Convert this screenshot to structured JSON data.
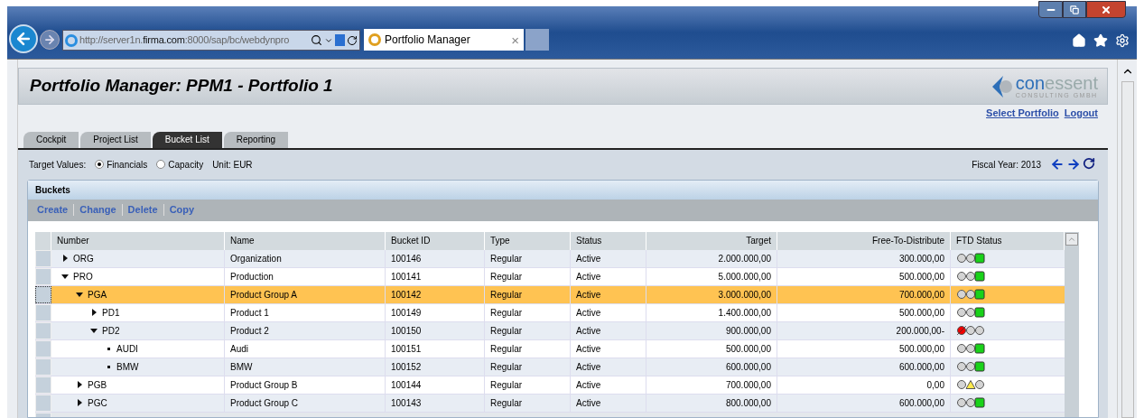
{
  "browser": {
    "address": "http://server1n.**firma.com**:8000/sap/bc/webdynpro",
    "tab_title": "Portfolio Manager",
    "tab_close": "×"
  },
  "app": {
    "title": "Portfolio Manager: PPM1 - Portfolio 1",
    "logo": {
      "part1": "con",
      "part2": "essent",
      "tagline": "CONSULTING GMBH"
    },
    "links": [
      "Select Portfolio",
      "Logout"
    ]
  },
  "tabs": [
    {
      "label": "Cockpit",
      "selected": false
    },
    {
      "label": "Project List",
      "selected": false
    },
    {
      "label": "Bucket List",
      "selected": true
    },
    {
      "label": "Reporting",
      "selected": false
    }
  ],
  "options": {
    "label": "Target Values:",
    "radios": [
      {
        "label": "Financials",
        "selected": true
      },
      {
        "label": "Capacity",
        "selected": false
      }
    ],
    "unit": "Unit: EUR",
    "fiscal_year": "Fiscal Year: 2013"
  },
  "buckets": {
    "title": "Buckets",
    "actions": [
      "Create",
      "Change",
      "Delete",
      "Copy"
    ],
    "columns": [
      "Number",
      "Name",
      "Bucket ID",
      "Type",
      "Status",
      "Target",
      "Free-To-Distribute",
      "FTD Status"
    ],
    "rows": [
      {
        "number": "ORG",
        "name": "Organization",
        "bucket_id": "100146",
        "type": "Regular",
        "status": "Active",
        "target": "2.000.000,00",
        "ftd": "300.000,00",
        "kind": "ok",
        "selected": false,
        "expanded": false
      },
      {
        "number": "PRO",
        "name": "Production",
        "bucket_id": "100141",
        "type": "Regular",
        "status": "Active",
        "target": "5.000.000,00",
        "ftd": "500.000,00",
        "kind": "ok",
        "selected": false,
        "expanded": true,
        "children": [
          {
            "number": "PGA",
            "name": "Product Group A",
            "bucket_id": "100142",
            "type": "Regular",
            "status": "Active",
            "target": "3.000.000,00",
            "ftd": "700.000,00",
            "kind": "ok",
            "selected": true,
            "expanded": true,
            "children": [
              {
                "number": "PD1",
                "name": "Product 1",
                "bucket_id": "100149",
                "type": "Regular",
                "status": "Active",
                "target": "1.400.000,00",
                "ftd": "500.000,00",
                "kind": "ok",
                "selected": false,
                "expanded": false
              },
              {
                "number": "PD2",
                "name": "Product 2",
                "bucket_id": "100150",
                "type": "Regular",
                "status": "Active",
                "target": "900.000,00",
                "ftd": "200.000,00-",
                "kind": "alert",
                "selected": false,
                "expanded": true,
                "children": [
                  {
                    "number": "AUDI",
                    "name": "Audi",
                    "bucket_id": "100151",
                    "type": "Regular",
                    "status": "Active",
                    "target": "500.000,00",
                    "ftd": "500.000,00",
                    "kind": "ok",
                    "selected": false
                  },
                  {
                    "number": "BMW",
                    "name": "BMW",
                    "bucket_id": "100152",
                    "type": "Regular",
                    "status": "Active",
                    "target": "600.000,00",
                    "ftd": "600.000,00",
                    "kind": "ok",
                    "selected": false
                  }
                ]
              }
            ]
          },
          {
            "number": "PGB",
            "name": "Product Group B",
            "bucket_id": "100144",
            "type": "Regular",
            "status": "Active",
            "target": "700.000,00",
            "ftd": "0,00",
            "kind": "warning",
            "selected": false,
            "expanded": false
          },
          {
            "number": "PGC",
            "name": "Product Group C",
            "bucket_id": "100143",
            "type": "Regular",
            "status": "Active",
            "target": "800.000,00",
            "ftd": "600.000,00",
            "kind": "ok",
            "selected": false,
            "expanded": false
          }
        ]
      }
    ]
  }
}
